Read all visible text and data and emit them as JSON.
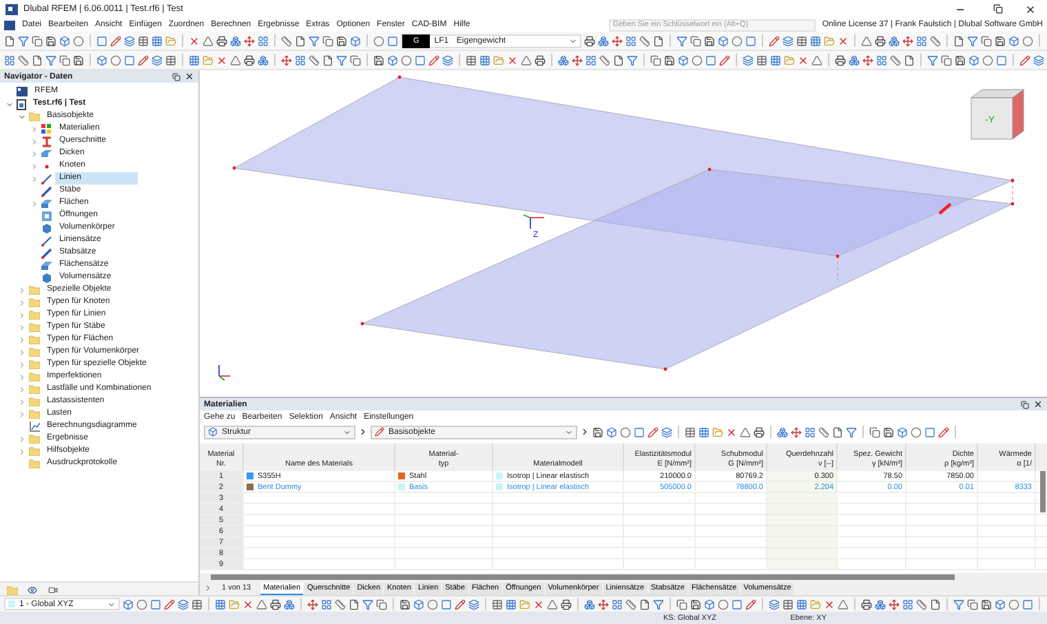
{
  "window": {
    "title": "Dlubal RFEM | 6.06.0011 | Test.rf6 | Test"
  },
  "menu": [
    "Datei",
    "Bearbeiten",
    "Ansicht",
    "Einfügen",
    "Zuordnen",
    "Berechnen",
    "Ergebnisse",
    "Extras",
    "Optionen",
    "Fenster",
    "CAD-BIM",
    "Hilfe"
  ],
  "search": {
    "placeholder": "Geben Sie ein Schlüsselwort ein (Alt+Q)"
  },
  "license": "Online License 37 | Frank Faulstich | Dlubal Software GmbH",
  "load_case": {
    "badge": "G",
    "code": "LF1",
    "name": "Eigengewicht"
  },
  "navigator": {
    "title": "Navigator - Daten",
    "tree": [
      {
        "label": "RFEM",
        "kind": "app",
        "selected": false
      },
      {
        "label": "Test.rf6 | Test",
        "kind": "file",
        "expanded": true,
        "selected": false,
        "children": [
          {
            "label": "Basisobjekte",
            "kind": "folder",
            "expanded": true,
            "selected": false,
            "children": [
              {
                "label": "Materialien",
                "kind": "materials",
                "expanded": false,
                "selected": false
              },
              {
                "label": "Querschnitte",
                "kind": "section",
                "expanded": false,
                "selected": false
              },
              {
                "label": "Dicken",
                "kind": "thickness",
                "expanded": false,
                "selected": false
              },
              {
                "label": "Knoten",
                "kind": "node",
                "expanded": false,
                "selected": false
              },
              {
                "label": "Linien",
                "kind": "line",
                "expanded": false,
                "selected": true
              },
              {
                "label": "Stäbe",
                "kind": "member",
                "selected": false
              },
              {
                "label": "Flächen",
                "kind": "surface",
                "expanded": false,
                "selected": false
              },
              {
                "label": "Öffnungen",
                "kind": "opening",
                "selected": false
              },
              {
                "label": "Volumenkörper",
                "kind": "solid",
                "selected": false
              },
              {
                "label": "Liniensätze",
                "kind": "line",
                "selected": false
              },
              {
                "label": "Stabsätze",
                "kind": "member",
                "selected": false
              },
              {
                "label": "Flächensätze",
                "kind": "surface",
                "selected": false
              },
              {
                "label": "Volumensätze",
                "kind": "solid",
                "selected": false
              }
            ]
          },
          {
            "label": "Spezielle Objekte",
            "kind": "folder",
            "expanded": false,
            "selected": false
          },
          {
            "label": "Typen für Knoten",
            "kind": "folder",
            "expanded": false,
            "selected": false
          },
          {
            "label": "Typen für Linien",
            "kind": "folder",
            "expanded": false,
            "selected": false
          },
          {
            "label": "Typen für Stäbe",
            "kind": "folder",
            "expanded": false,
            "selected": false
          },
          {
            "label": "Typen für Flächen",
            "kind": "folder",
            "expanded": false,
            "selected": false
          },
          {
            "label": "Typen für Volumenkörper",
            "kind": "folder",
            "expanded": false,
            "selected": false
          },
          {
            "label": "Typen für spezielle Objekte",
            "kind": "folder",
            "expanded": false,
            "selected": false
          },
          {
            "label": "Imperfektionen",
            "kind": "folder",
            "expanded": false,
            "selected": false
          },
          {
            "label": "Lastfälle und Kombinationen",
            "kind": "folder",
            "expanded": false,
            "selected": false
          },
          {
            "label": "Lastassistenten",
            "kind": "folder",
            "expanded": false,
            "selected": false
          },
          {
            "label": "Lasten",
            "kind": "folder",
            "expanded": false,
            "selected": false
          },
          {
            "label": "Berechnungsdiagramme",
            "kind": "diagram",
            "selected": false
          },
          {
            "label": "Ergebnisse",
            "kind": "folder",
            "expanded": false,
            "selected": false
          },
          {
            "label": "Hilfsobjekte",
            "kind": "folder",
            "expanded": false,
            "selected": false
          },
          {
            "label": "Ausdruckprotokolle",
            "kind": "folder",
            "selected": false
          }
        ]
      }
    ]
  },
  "view_selector": "1 - Global XYZ",
  "viewport": {
    "origin_label": "Z",
    "cube_face": "-Y"
  },
  "panel": {
    "title": "Materialien",
    "menu": [
      "Gehe zu",
      "Bearbeiten",
      "Selektion",
      "Ansicht",
      "Einstellungen"
    ],
    "combos": [
      "Struktur",
      "Basisobjekte"
    ],
    "columns": [
      [
        "Material",
        "Nr."
      ],
      [
        "Name des Materials"
      ],
      [
        "Material-",
        "typ"
      ],
      [
        "Materialmodell"
      ],
      [
        "Elastizitätsmodul",
        "E [N/mm²]"
      ],
      [
        "Schubmodul",
        "G [N/mm²]"
      ],
      [
        "Querdehnzahl",
        "ν [--]"
      ],
      [
        "Spez. Gewicht",
        "γ [kN/m³]"
      ],
      [
        "Dichte",
        "ρ [kg/m³]"
      ],
      [
        "Wärmede",
        "α [1/"
      ]
    ],
    "rows": [
      {
        "nr": "1",
        "name": {
          "text": "S355H",
          "color": "#3399ff"
        },
        "type": {
          "text": "Stahl",
          "color": "#e8641e"
        },
        "model": {
          "text": "Isotrop | Linear elastisch",
          "color": "#c8f4f8"
        },
        "values": [
          "210000.0",
          "80769.2",
          "0.300",
          "78.50",
          "7850.00"
        ],
        "user_defined": false
      },
      {
        "nr": "2",
        "name": {
          "text": "Bent Dummy",
          "color": "#8b6f4e"
        },
        "type": {
          "text": "Basis",
          "color": "#c8f4f8"
        },
        "model": {
          "text": "Isotrop | Linear elastisch",
          "color": "#c8f4f8"
        },
        "values": [
          "505000.0",
          "78800.0",
          "2.204",
          "0.00",
          "0.01",
          "8333"
        ],
        "user_defined": true
      },
      {
        "nr": "3"
      },
      {
        "nr": "4"
      },
      {
        "nr": "5"
      },
      {
        "nr": "6"
      },
      {
        "nr": "7"
      },
      {
        "nr": "8"
      },
      {
        "nr": "9"
      }
    ],
    "pager": "1 von 13",
    "tabs": [
      {
        "label": "Materialien",
        "selected": true
      },
      {
        "label": "Querschnitte",
        "selected": false
      },
      {
        "label": "Dicken",
        "selected": false
      },
      {
        "label": "Knoten",
        "selected": false
      },
      {
        "label": "Linien",
        "selected": false
      },
      {
        "label": "Stäbe",
        "selected": false
      },
      {
        "label": "Flächen",
        "selected": false
      },
      {
        "label": "Öffnungen",
        "selected": false
      },
      {
        "label": "Volumenkörper",
        "selected": false
      },
      {
        "label": "Liniensätze",
        "selected": false
      },
      {
        "label": "Stabsätze",
        "selected": false
      },
      {
        "label": "Flächensätze",
        "selected": false
      },
      {
        "label": "Volumensätze",
        "selected": false
      }
    ]
  },
  "status_bar": [
    "KS: Global XYZ",
    "Ebene: XY"
  ]
}
